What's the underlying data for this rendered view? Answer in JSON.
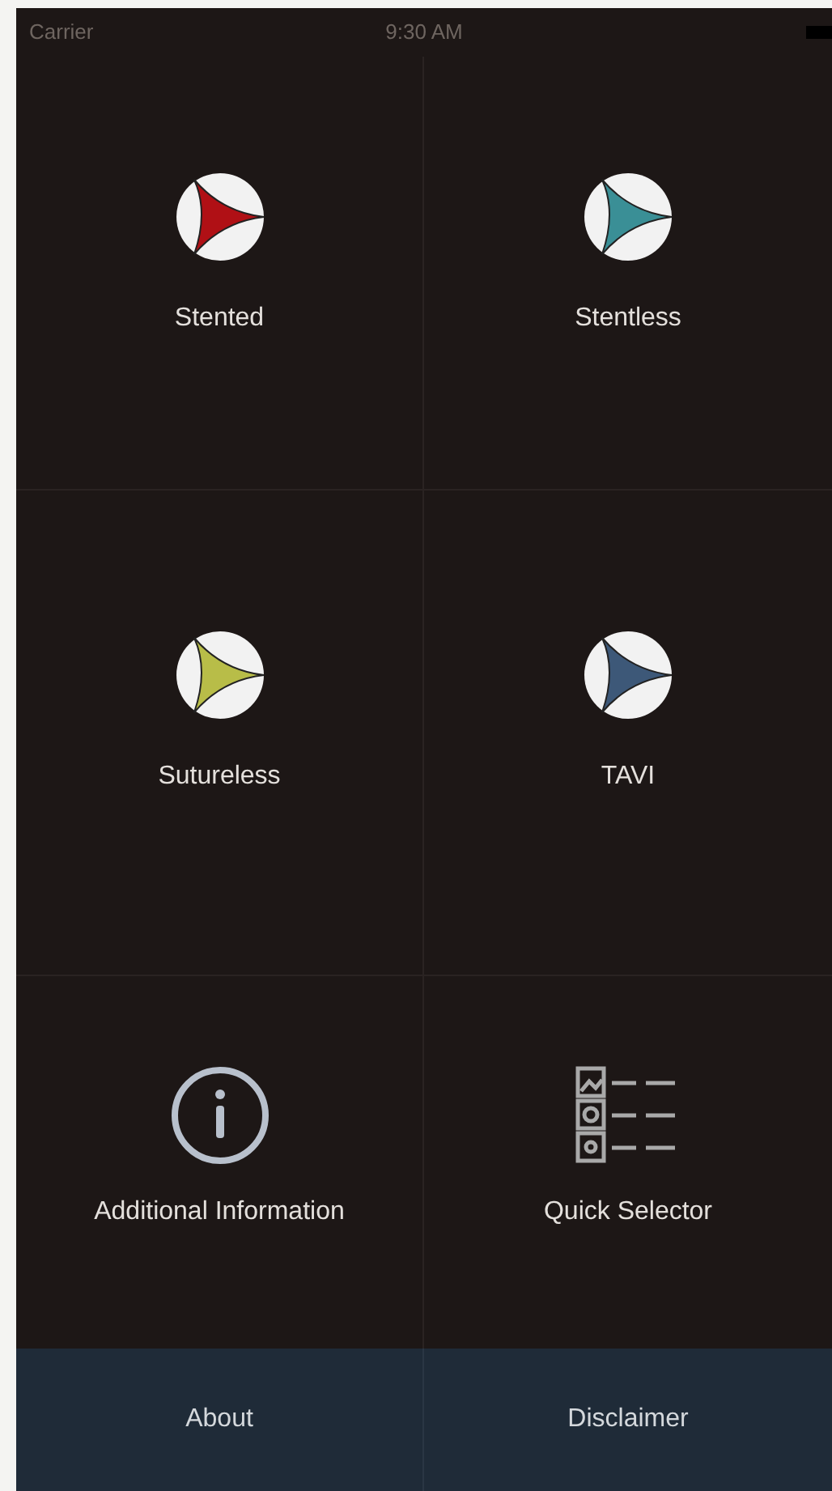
{
  "status_bar": {
    "carrier": "Carrier",
    "time": "9:30 AM"
  },
  "tiles": [
    {
      "kind": "valve",
      "label": "Stented",
      "color": "#b01015"
    },
    {
      "kind": "valve",
      "label": "Stentless",
      "color": "#3a8f96"
    },
    {
      "kind": "valve",
      "label": "Sutureless",
      "color": "#b8bd48"
    },
    {
      "kind": "valve",
      "label": "TAVI",
      "color": "#3d5878"
    },
    {
      "kind": "info",
      "label": "Additional Information"
    },
    {
      "kind": "selector",
      "label": "Quick Selector"
    }
  ],
  "bottom_bar": [
    "About",
    "Disclaimer"
  ]
}
